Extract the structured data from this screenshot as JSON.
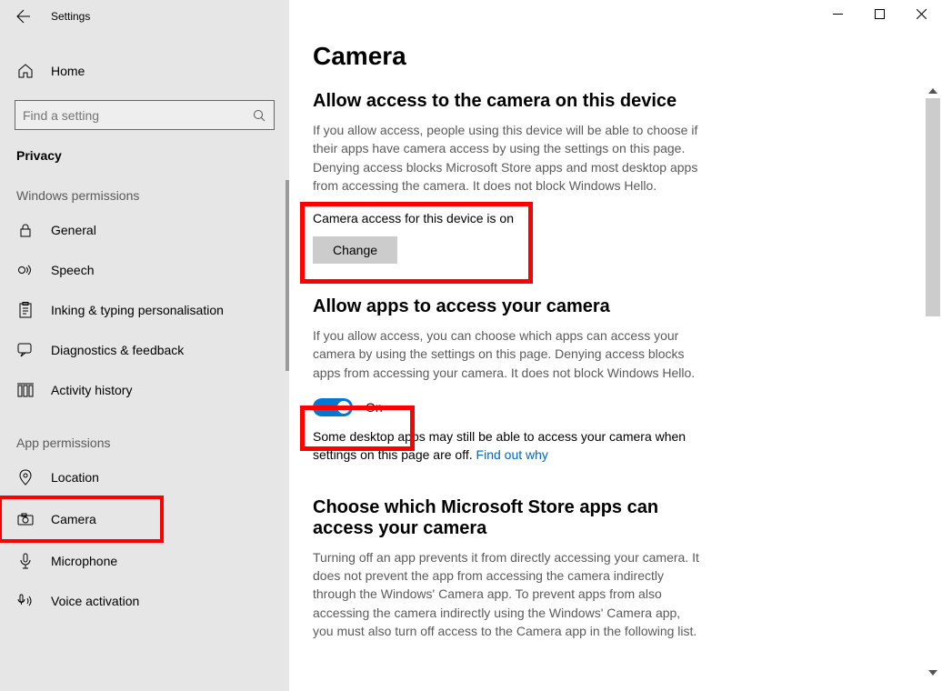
{
  "window": {
    "title": "Settings",
    "home": "Home",
    "search_placeholder": "Find a setting",
    "category": "Privacy"
  },
  "sidebar": {
    "win_perms_label": "Windows permissions",
    "win_perms": [
      {
        "label": "General"
      },
      {
        "label": "Speech"
      },
      {
        "label": "Inking & typing personalisation"
      },
      {
        "label": "Diagnostics & feedback"
      },
      {
        "label": "Activity history"
      }
    ],
    "app_perms_label": "App permissions",
    "app_perms": [
      {
        "label": "Location"
      },
      {
        "label": "Camera"
      },
      {
        "label": "Microphone"
      },
      {
        "label": "Voice activation"
      }
    ]
  },
  "main": {
    "title": "Camera",
    "s1_title": "Allow access to the camera on this device",
    "s1_body": "If you allow access, people using this device will be able to choose if their apps have camera access by using the settings on this page. Denying access blocks Microsoft Store apps and most desktop apps from accessing the camera. It does not block Windows Hello.",
    "s1_status": "Camera access for this device is on",
    "s1_change": "Change",
    "s2_title": "Allow apps to access your camera",
    "s2_body": "If you allow access, you can choose which apps can access your camera by using the settings on this page. Denying access blocks apps from accessing your camera. It does not block Windows Hello.",
    "s2_toggle": "On",
    "s2_note_a": "Some desktop apps may still be able to access your camera when settings on this page are off. ",
    "s2_note_link": "Find out why",
    "s3_title": "Choose which Microsoft Store apps can access your camera",
    "s3_body": "Turning off an app prevents it from directly accessing your camera. It does not prevent the app from accessing the camera indirectly through the Windows' Camera app. To prevent apps from also accessing the camera indirectly using the Windows' Camera app, you must also turn off access to the Camera app in the following list."
  }
}
